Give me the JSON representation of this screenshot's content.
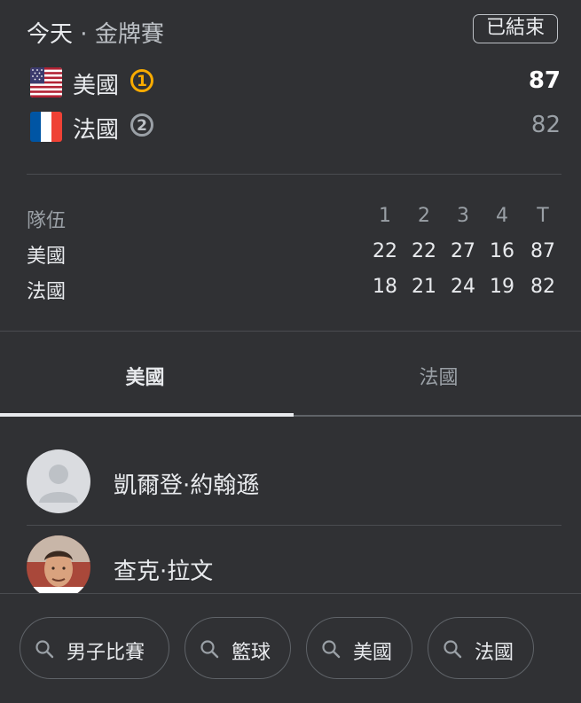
{
  "header": {
    "day": "今天",
    "separator": " · ",
    "event": "金牌賽",
    "status": "已結束"
  },
  "teams": [
    {
      "name": "美國",
      "rank": "1",
      "score": "87",
      "flag": "us-flag",
      "result": "win"
    },
    {
      "name": "法國",
      "rank": "2",
      "score": "82",
      "flag": "france-flag",
      "result": "lose"
    }
  ],
  "box_score": {
    "header": {
      "label": "隊伍",
      "q1": "1",
      "q2": "2",
      "q3": "3",
      "q4": "4",
      "total": "T"
    },
    "rows": [
      {
        "team": "美國",
        "q1": "22",
        "q2": "22",
        "q3": "27",
        "q4": "16",
        "total": "87"
      },
      {
        "team": "法國",
        "q1": "18",
        "q2": "21",
        "q3": "24",
        "q4": "19",
        "total": "82"
      }
    ]
  },
  "tabs": [
    {
      "label": "美國",
      "active": true
    },
    {
      "label": "法國",
      "active": false
    }
  ],
  "players": [
    {
      "name": "凱爾登·約翰遜",
      "avatar": "placeholder-avatar"
    },
    {
      "name": "查克·拉文",
      "avatar": "player-photo"
    }
  ],
  "chips": [
    {
      "label": "男子比賽",
      "icon": "search-icon"
    },
    {
      "label": "籃球",
      "icon": "search-icon"
    },
    {
      "label": "美國",
      "icon": "search-icon"
    },
    {
      "label": "法國",
      "icon": "search-icon"
    }
  ],
  "colors": {
    "background": "#303134",
    "gold": "#f9ab00",
    "silver": "#9aa0a6"
  }
}
